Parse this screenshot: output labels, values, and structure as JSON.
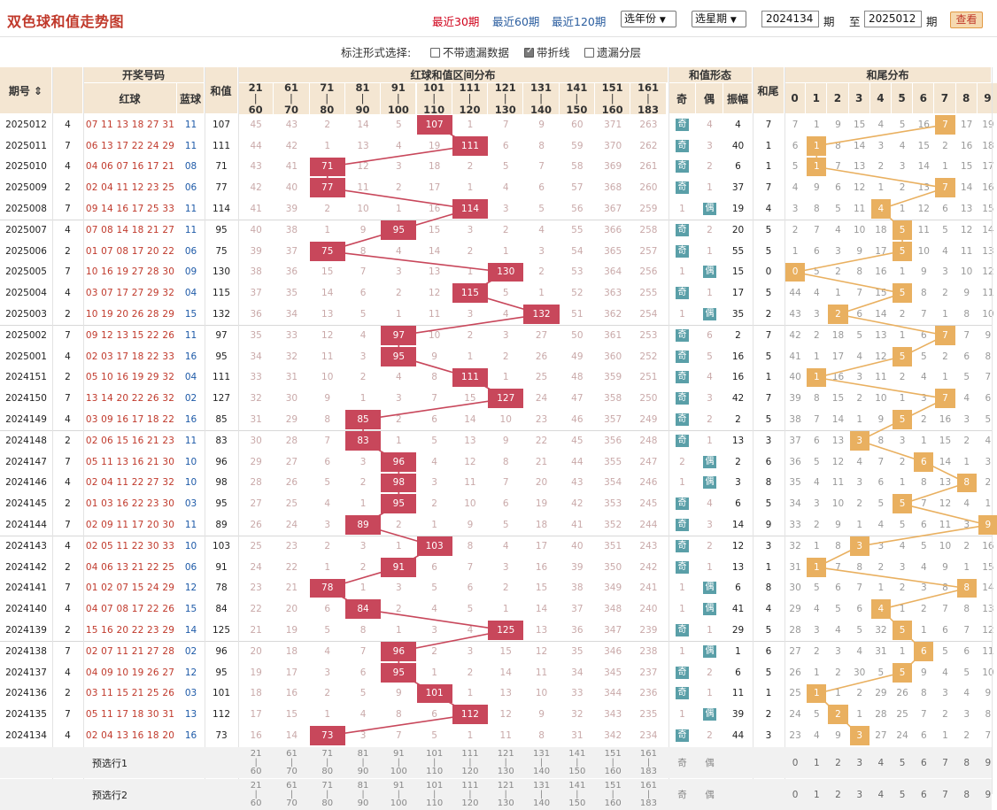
{
  "title": "双色球和值走势图",
  "periods": [
    "最近30期",
    "最近60期",
    "最近120期"
  ],
  "active_period": 0,
  "year_select": "选年份",
  "issue_select": "选星期",
  "from_issue": "2024134",
  "from_label": "期",
  "to_label": "至",
  "to_issue": "2025012",
  "to_suffix": "期",
  "view_button": "查看",
  "options": {
    "label": "标注形式选择:",
    "items": [
      {
        "text": "不带遗漏数据",
        "checked": false
      },
      {
        "text": "带折线",
        "checked": true
      },
      {
        "text": "遗漏分层",
        "checked": false
      }
    ]
  },
  "headers": {
    "issue": "期号",
    "weekday": "星期",
    "draw": "开奖号码",
    "red": "红球",
    "blue": "蓝球",
    "sum": "和值",
    "zone": "红球和值区间分布",
    "shape": "和值形态",
    "odd": "奇",
    "even": "偶",
    "amp": "振幅",
    "tail": "和尾",
    "tail_dist": "和尾分布",
    "ranges": [
      [
        "21",
        "60"
      ],
      [
        "61",
        "70"
      ],
      [
        "71",
        "80"
      ],
      [
        "81",
        "90"
      ],
      [
        "91",
        "100"
      ],
      [
        "101",
        "110"
      ],
      [
        "111",
        "120"
      ],
      [
        "121",
        "130"
      ],
      [
        "131",
        "140"
      ],
      [
        "141",
        "150"
      ],
      [
        "151",
        "160"
      ],
      [
        "161",
        "183"
      ]
    ],
    "tails": [
      "0",
      "1",
      "2",
      "3",
      "4",
      "5",
      "6",
      "7",
      "8",
      "9"
    ]
  },
  "rows": [
    {
      "issue": "2025012",
      "week": "4",
      "red": "07 11 13 18 27 31",
      "blue": "11",
      "sum": "107",
      "zone": [
        45,
        43,
        2,
        14,
        5,
        null,
        1,
        7,
        9,
        60,
        371,
        263
      ],
      "odd": true,
      "sm": "4",
      "amp": "4",
      "tail": "7",
      "td": [
        7,
        1,
        9,
        15,
        4,
        5,
        16,
        null,
        17,
        19
      ]
    },
    {
      "issue": "2025011",
      "week": "7",
      "red": "06 13 17 22 24 29",
      "blue": "11",
      "sum": "111",
      "zone": [
        44,
        42,
        1,
        13,
        4,
        19,
        null,
        6,
        8,
        59,
        370,
        262
      ],
      "odd": true,
      "sm": "3",
      "amp": "40",
      "tail": "1",
      "td": [
        6,
        null,
        8,
        14,
        3,
        4,
        15,
        2,
        16,
        18
      ]
    },
    {
      "issue": "2025010",
      "week": "4",
      "red": "04 06 07 16 17 21",
      "blue": "08",
      "sum": "71",
      "zone": [
        43,
        41,
        null,
        12,
        3,
        18,
        2,
        5,
        7,
        58,
        369,
        261
      ],
      "odd": true,
      "sm": "2",
      "amp": "6",
      "tail": "1",
      "td": [
        5,
        null,
        7,
        13,
        2,
        3,
        14,
        1,
        15,
        17
      ]
    },
    {
      "issue": "2025009",
      "week": "2",
      "red": "02 04 11 12 23 25",
      "blue": "06",
      "sum": "77",
      "zone": [
        42,
        40,
        null,
        11,
        2,
        17,
        1,
        4,
        6,
        57,
        368,
        260
      ],
      "odd": true,
      "sm": "1",
      "amp": "37",
      "tail": "7",
      "td": [
        4,
        9,
        6,
        12,
        1,
        2,
        13,
        null,
        14,
        16
      ]
    },
    {
      "issue": "2025008",
      "week": "7",
      "red": "09 14 16 17 25 33",
      "blue": "11",
      "sum": "114",
      "zone": [
        41,
        39,
        2,
        10,
        1,
        16,
        null,
        3,
        5,
        56,
        367,
        259
      ],
      "odd": false,
      "sm": "1",
      "amp": "19",
      "tail": "4",
      "td": [
        3,
        8,
        5,
        11,
        null,
        1,
        12,
        6,
        13,
        15
      ]
    },
    {
      "issue": "2025007",
      "week": "4",
      "red": "07 08 14 18 21 27",
      "blue": "11",
      "sum": "95",
      "zone": [
        40,
        38,
        1,
        9,
        null,
        15,
        3,
        2,
        4,
        55,
        366,
        258
      ],
      "odd": true,
      "sm": "2",
      "amp": "20",
      "tail": "5",
      "td": [
        2,
        7,
        4,
        10,
        18,
        null,
        11,
        5,
        12,
        14
      ]
    },
    {
      "issue": "2025006",
      "week": "2",
      "red": "01 07 08 17 20 22",
      "blue": "06",
      "sum": "75",
      "zone": [
        39,
        37,
        null,
        8,
        4,
        14,
        2,
        1,
        3,
        54,
        365,
        257
      ],
      "odd": true,
      "sm": "1",
      "amp": "55",
      "tail": "5",
      "td": [
        1,
        6,
        3,
        9,
        17,
        null,
        10,
        4,
        11,
        13
      ]
    },
    {
      "issue": "2025005",
      "week": "7",
      "red": "10 16 19 27 28 30",
      "blue": "09",
      "sum": "130",
      "zone": [
        38,
        36,
        15,
        7,
        3,
        13,
        1,
        null,
        2,
        53,
        364,
        256
      ],
      "odd": false,
      "sm": "1",
      "amp": "15",
      "tail": "0",
      "td": [
        null,
        5,
        2,
        8,
        16,
        1,
        9,
        3,
        10,
        12
      ]
    },
    {
      "issue": "2025004",
      "week": "4",
      "red": "03 07 17 27 29 32",
      "blue": "04",
      "sum": "115",
      "zone": [
        37,
        35,
        14,
        6,
        2,
        12,
        null,
        5,
        1,
        52,
        363,
        255
      ],
      "odd": true,
      "sm": "1",
      "amp": "17",
      "tail": "5",
      "td": [
        44,
        4,
        1,
        7,
        15,
        null,
        8,
        2,
        9,
        11
      ]
    },
    {
      "issue": "2025003",
      "week": "2",
      "red": "10 19 20 26 28 29",
      "blue": "15",
      "sum": "132",
      "zone": [
        36,
        34,
        13,
        5,
        1,
        11,
        3,
        4,
        null,
        51,
        362,
        254
      ],
      "odd": false,
      "sm": "1",
      "amp": "35",
      "tail": "2",
      "td": [
        43,
        3,
        null,
        6,
        14,
        2,
        7,
        1,
        8,
        10
      ]
    },
    {
      "issue": "2025002",
      "week": "7",
      "red": "09 12 13 15 22 26",
      "blue": "11",
      "sum": "97",
      "zone": [
        35,
        33,
        12,
        4,
        null,
        10,
        2,
        3,
        27,
        50,
        361,
        253
      ],
      "odd": true,
      "sm": "6",
      "amp": "2",
      "tail": "7",
      "td": [
        42,
        2,
        18,
        5,
        13,
        1,
        6,
        null,
        7,
        9
      ]
    },
    {
      "issue": "2025001",
      "week": "4",
      "red": "02 03 17 18 22 33",
      "blue": "16",
      "sum": "95",
      "zone": [
        34,
        32,
        11,
        3,
        null,
        9,
        1,
        2,
        26,
        49,
        360,
        252
      ],
      "odd": true,
      "sm": "5",
      "amp": "16",
      "tail": "5",
      "td": [
        41,
        1,
        17,
        4,
        12,
        null,
        5,
        2,
        6,
        8
      ]
    },
    {
      "issue": "2024151",
      "week": "2",
      "red": "05 10 16 19 29 32",
      "blue": "04",
      "sum": "111",
      "zone": [
        33,
        31,
        10,
        2,
        4,
        8,
        null,
        1,
        25,
        48,
        359,
        251
      ],
      "odd": true,
      "sm": "4",
      "amp": "16",
      "tail": "1",
      "td": [
        40,
        null,
        16,
        3,
        11,
        2,
        4,
        1,
        5,
        7
      ]
    },
    {
      "issue": "2024150",
      "week": "7",
      "red": "13 14 20 22 26 32",
      "blue": "02",
      "sum": "127",
      "zone": [
        32,
        30,
        9,
        1,
        3,
        7,
        15,
        null,
        24,
        47,
        358,
        250
      ],
      "odd": true,
      "sm": "3",
      "amp": "42",
      "tail": "7",
      "td": [
        39,
        8,
        15,
        2,
        10,
        1,
        3,
        null,
        4,
        6
      ]
    },
    {
      "issue": "2024149",
      "week": "4",
      "red": "03 09 16 17 18 22",
      "blue": "16",
      "sum": "85",
      "zone": [
        31,
        29,
        8,
        null,
        2,
        6,
        14,
        10,
        23,
        46,
        357,
        249
      ],
      "odd": true,
      "sm": "2",
      "amp": "2",
      "tail": "5",
      "td": [
        38,
        7,
        14,
        1,
        9,
        null,
        2,
        16,
        3,
        5
      ]
    },
    {
      "issue": "2024148",
      "week": "2",
      "red": "02 06 15 16 21 23",
      "blue": "11",
      "sum": "83",
      "zone": [
        30,
        28,
        7,
        null,
        1,
        5,
        13,
        9,
        22,
        45,
        356,
        248
      ],
      "odd": true,
      "sm": "1",
      "amp": "13",
      "tail": "3",
      "td": [
        37,
        6,
        13,
        null,
        8,
        3,
        1,
        15,
        2,
        4
      ]
    },
    {
      "issue": "2024147",
      "week": "7",
      "red": "05 11 13 16 21 30",
      "blue": "10",
      "sum": "96",
      "zone": [
        29,
        27,
        6,
        3,
        null,
        4,
        12,
        8,
        21,
        44,
        355,
        247
      ],
      "odd": false,
      "sm": "2",
      "amp": "2",
      "tail": "6",
      "td": [
        36,
        5,
        12,
        4,
        7,
        2,
        null,
        14,
        1,
        3
      ]
    },
    {
      "issue": "2024146",
      "week": "4",
      "red": "02 04 11 22 27 32",
      "blue": "10",
      "sum": "98",
      "zone": [
        28,
        26,
        5,
        2,
        null,
        3,
        11,
        7,
        20,
        43,
        354,
        246
      ],
      "odd": false,
      "sm": "1",
      "amp": "3",
      "tail": "8",
      "td": [
        35,
        4,
        11,
        3,
        6,
        1,
        8,
        13,
        null,
        2
      ]
    },
    {
      "issue": "2024145",
      "week": "2",
      "red": "01 03 16 22 23 30",
      "blue": "03",
      "sum": "95",
      "zone": [
        27,
        25,
        4,
        1,
        null,
        2,
        10,
        6,
        19,
        42,
        353,
        245
      ],
      "odd": true,
      "sm": "4",
      "amp": "6",
      "tail": "5",
      "td": [
        34,
        3,
        10,
        2,
        5,
        null,
        7,
        12,
        4,
        1
      ]
    },
    {
      "issue": "2024144",
      "week": "7",
      "red": "02 09 11 17 20 30",
      "blue": "11",
      "sum": "89",
      "zone": [
        26,
        24,
        3,
        null,
        2,
        1,
        9,
        5,
        18,
        41,
        352,
        244
      ],
      "odd": true,
      "sm": "3",
      "amp": "14",
      "tail": "9",
      "td": [
        33,
        2,
        9,
        1,
        4,
        5,
        6,
        11,
        3,
        null
      ]
    },
    {
      "issue": "2024143",
      "week": "4",
      "red": "02 05 11 22 30 33",
      "blue": "10",
      "sum": "103",
      "zone": [
        25,
        23,
        2,
        3,
        1,
        null,
        8,
        4,
        17,
        40,
        351,
        243
      ],
      "odd": true,
      "sm": "2",
      "amp": "12",
      "tail": "3",
      "td": [
        32,
        1,
        8,
        null,
        3,
        4,
        5,
        10,
        2,
        16
      ]
    },
    {
      "issue": "2024142",
      "week": "2",
      "red": "04 06 13 21 22 25",
      "blue": "06",
      "sum": "91",
      "zone": [
        24,
        22,
        1,
        2,
        null,
        6,
        7,
        3,
        16,
        39,
        350,
        242
      ],
      "odd": true,
      "sm": "1",
      "amp": "13",
      "tail": "1",
      "td": [
        31,
        null,
        7,
        8,
        2,
        3,
        4,
        9,
        1,
        15
      ]
    },
    {
      "issue": "2024141",
      "week": "7",
      "red": "01 02 07 15 24 29",
      "blue": "12",
      "sum": "78",
      "zone": [
        23,
        21,
        null,
        1,
        3,
        5,
        6,
        2,
        15,
        38,
        349,
        241
      ],
      "odd": false,
      "sm": "1",
      "amp": "6",
      "tail": "8",
      "td": [
        30,
        5,
        6,
        7,
        1,
        2,
        3,
        8,
        null,
        14
      ]
    },
    {
      "issue": "2024140",
      "week": "4",
      "red": "04 07 08 17 22 26",
      "blue": "15",
      "sum": "84",
      "zone": [
        22,
        20,
        6,
        null,
        2,
        4,
        5,
        1,
        14,
        37,
        348,
        240
      ],
      "odd": false,
      "sm": "1",
      "amp": "41",
      "tail": "4",
      "td": [
        29,
        4,
        5,
        6,
        null,
        1,
        2,
        7,
        8,
        13
      ]
    },
    {
      "issue": "2024139",
      "week": "2",
      "red": "15 16 20 22 23 29",
      "blue": "14",
      "sum": "125",
      "zone": [
        21,
        19,
        5,
        8,
        1,
        3,
        4,
        null,
        13,
        36,
        347,
        239
      ],
      "odd": true,
      "sm": "1",
      "amp": "29",
      "tail": "5",
      "td": [
        28,
        3,
        4,
        5,
        32,
        null,
        1,
        6,
        7,
        12
      ]
    },
    {
      "issue": "2024138",
      "week": "7",
      "red": "02 07 11 21 27 28",
      "blue": "02",
      "sum": "96",
      "zone": [
        20,
        18,
        4,
        7,
        null,
        2,
        3,
        15,
        12,
        35,
        346,
        238
      ],
      "odd": false,
      "sm": "1",
      "amp": "1",
      "tail": "6",
      "td": [
        27,
        2,
        3,
        4,
        31,
        1,
        null,
        5,
        6,
        11
      ]
    },
    {
      "issue": "2024137",
      "week": "4",
      "red": "04 09 10 19 26 27",
      "blue": "12",
      "sum": "95",
      "zone": [
        19,
        17,
        3,
        6,
        null,
        1,
        2,
        14,
        11,
        34,
        345,
        237
      ],
      "odd": true,
      "sm": "2",
      "amp": "6",
      "tail": "5",
      "td": [
        26,
        1,
        2,
        30,
        5,
        null,
        9,
        4,
        5,
        10
      ]
    },
    {
      "issue": "2024136",
      "week": "2",
      "red": "03 11 15 21 25 26",
      "blue": "03",
      "sum": "101",
      "zone": [
        18,
        16,
        2,
        5,
        9,
        null,
        1,
        13,
        10,
        33,
        344,
        236
      ],
      "odd": true,
      "sm": "1",
      "amp": "11",
      "tail": "1",
      "td": [
        25,
        null,
        1,
        2,
        29,
        26,
        8,
        3,
        4,
        9
      ]
    },
    {
      "issue": "2024135",
      "week": "7",
      "red": "05 11 17 18 30 31",
      "blue": "13",
      "sum": "112",
      "zone": [
        17,
        15,
        1,
        4,
        8,
        6,
        null,
        12,
        9,
        32,
        343,
        235
      ],
      "odd": false,
      "sm": "1",
      "amp": "39",
      "tail": "2",
      "td": [
        24,
        5,
        null,
        1,
        28,
        25,
        7,
        2,
        3,
        8
      ]
    },
    {
      "issue": "2024134",
      "week": "4",
      "red": "02 04 13 16 18 20",
      "blue": "16",
      "sum": "73",
      "zone": [
        16,
        14,
        null,
        3,
        7,
        5,
        1,
        11,
        8,
        31,
        342,
        234
      ],
      "odd": true,
      "sm": "2",
      "amp": "44",
      "tail": "3",
      "td": [
        23,
        4,
        9,
        null,
        27,
        24,
        6,
        1,
        2,
        7
      ]
    }
  ],
  "footer": {
    "pre1": "预选行1",
    "pre2": "预选行2",
    "odd": "奇",
    "even": "偶"
  }
}
